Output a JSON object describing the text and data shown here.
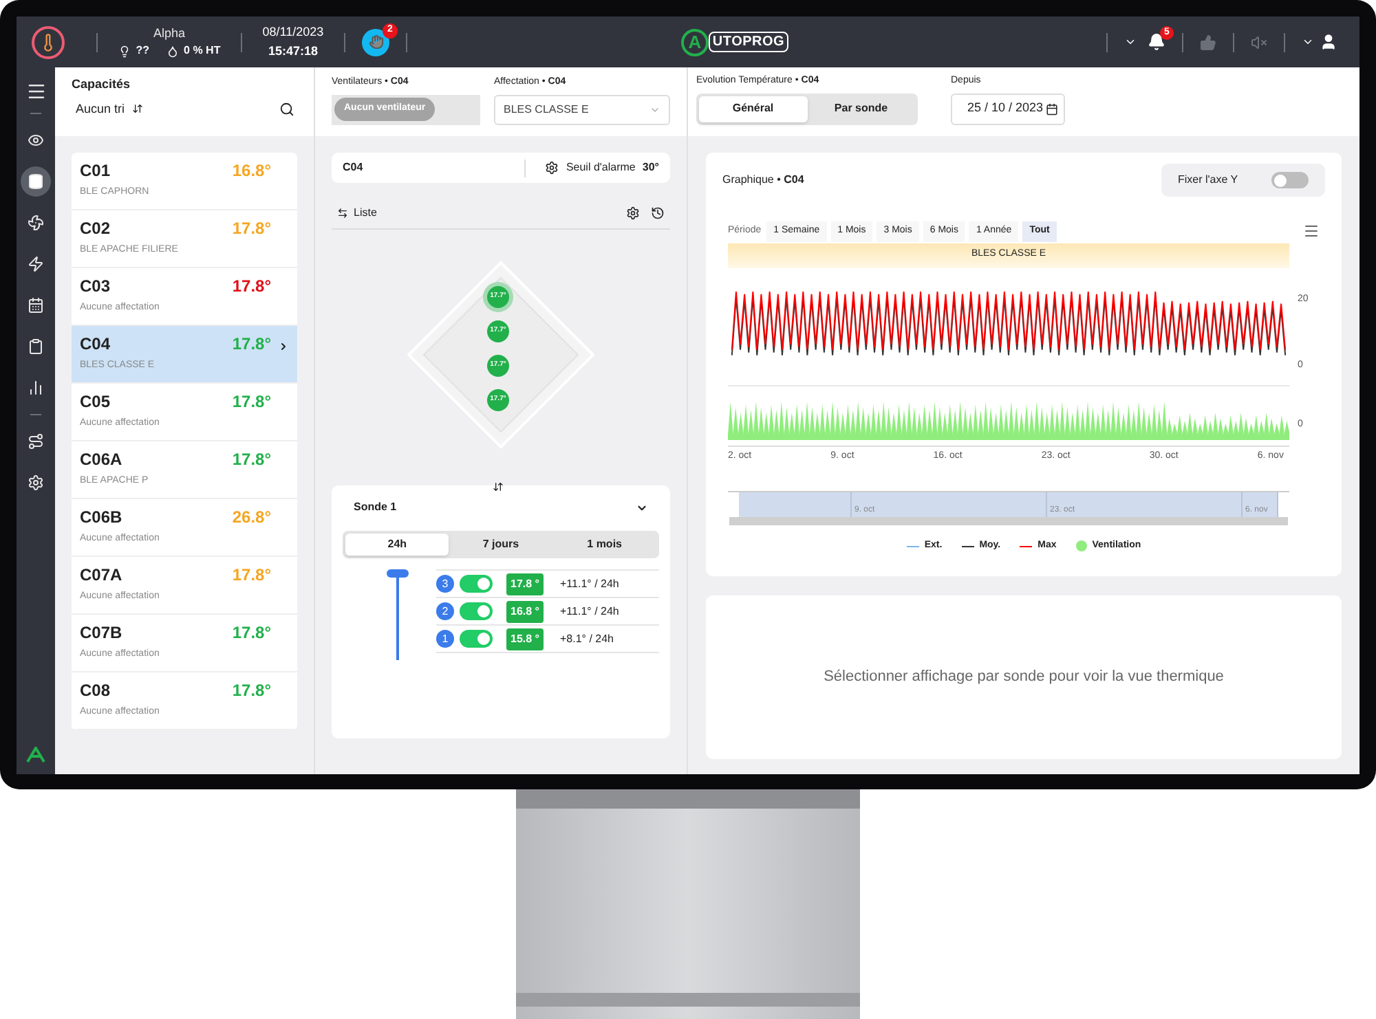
{
  "topbar": {
    "site": "Alpha",
    "sensor_value": "??",
    "humidity": "0 % HT",
    "date": "08/11/2023",
    "time": "15:47:18",
    "alerts_badge": "2",
    "logo_letter": "A",
    "logo_text": "UTOPROG",
    "notifications_badge": "5"
  },
  "nav": {
    "items": [
      {
        "selected": false
      },
      {
        "selected": true
      },
      {
        "selected": false
      },
      {
        "selected": false
      },
      {
        "selected": false
      },
      {
        "selected": false
      },
      {
        "selected": false
      },
      {
        "selected": false
      },
      {
        "selected": false
      }
    ]
  },
  "capacities": {
    "title": "Capacités",
    "sort": "Aucun tri",
    "items": [
      {
        "name": "C01",
        "assignment": "BLE CAPHORN",
        "temperature": "16.8°",
        "color": "#f5a623",
        "selected": false
      },
      {
        "name": "C02",
        "assignment": "BLE APACHE FILIERE",
        "temperature": "17.8°",
        "color": "#f5a623",
        "selected": false
      },
      {
        "name": "C03",
        "assignment": "Aucune affectation",
        "temperature": "17.8°",
        "color": "#e0101a",
        "selected": false
      },
      {
        "name": "C04",
        "assignment": "BLES CLASSE E",
        "temperature": "17.8°",
        "color": "#22b04b",
        "selected": true
      },
      {
        "name": "C05",
        "assignment": "Aucune affectation",
        "temperature": "17.8°",
        "color": "#22b04b",
        "selected": false
      },
      {
        "name": "C06A",
        "assignment": "BLE APACHE P",
        "temperature": "17.8°",
        "color": "#22b04b",
        "selected": false
      },
      {
        "name": "C06B",
        "assignment": "Aucune affectation",
        "temperature": "26.8°",
        "color": "#f5a623",
        "selected": false
      },
      {
        "name": "C07A",
        "assignment": "Aucune affectation",
        "temperature": "17.8°",
        "color": "#f5a623",
        "selected": false
      },
      {
        "name": "C07B",
        "assignment": "Aucune affectation",
        "temperature": "17.8°",
        "color": "#22b04b",
        "selected": false
      },
      {
        "name": "C08",
        "assignment": "Aucune affectation",
        "temperature": "17.8°",
        "color": "#22b04b",
        "selected": false
      }
    ]
  },
  "cell_header": {
    "fans_label": "Ventilateurs • **C04**",
    "fans_value": "Aucun ventilateur",
    "assignment_label": "Affectation • **C04**",
    "assignment_value": "BLES CLASSE E"
  },
  "cell": {
    "name": "C04",
    "alarm_label": "Seuil d'alarme",
    "alarm_value": "30°",
    "view_toggle": "Liste",
    "probes": [
      {
        "reading": "17.7°",
        "selected": true
      },
      {
        "reading": "17.7°",
        "selected": false
      },
      {
        "reading": "17.7°",
        "selected": false
      },
      {
        "reading": "17.7°",
        "selected": false
      }
    ]
  },
  "probe_panel": {
    "title": "Sonde 1",
    "tabs": [
      {
        "label": "24h",
        "selected": true
      },
      {
        "label": "7 jours",
        "selected": false
      },
      {
        "label": "1 mois",
        "selected": false
      }
    ],
    "depth_slider": {
      "level": 1
    },
    "sensors": [
      {
        "number": "3",
        "on": true,
        "temperature": "17.8 °",
        "trend": "+11.1° / 24h"
      },
      {
        "number": "2",
        "on": true,
        "temperature": "16.8 °",
        "trend": "+11.1° / 24h"
      },
      {
        "number": "1",
        "on": true,
        "temperature": "15.8 °",
        "trend": "+8.1° / 24h"
      }
    ]
  },
  "history": {
    "title": "Evolution Température • **C04**",
    "tabs": [
      {
        "label": "Général",
        "selected": true
      },
      {
        "label": "Par sonde",
        "selected": false
      }
    ],
    "since_label": "Depuis",
    "since_value": "25 / 10 / 2023",
    "chart_title": "Graphique • **C04**",
    "fix_axis": {
      "label": "Fixer l'axe Y",
      "on": false
    },
    "period_label": "Période",
    "periods": [
      {
        "label": "1 Semaine",
        "selected": false
      },
      {
        "label": "1 Mois",
        "selected": false
      },
      {
        "label": "3 Mois",
        "selected": false
      },
      {
        "label": "6 Mois",
        "selected": false
      },
      {
        "label": "1 Année",
        "selected": false
      },
      {
        "label": "Tout",
        "selected": true
      }
    ],
    "band": "BLES CLASSE E",
    "y_labels": [
      "20",
      "0"
    ],
    "ventilation_y_label": "0",
    "x_labels": [
      "2. oct",
      "9. oct",
      "16. oct",
      "23. oct",
      "30. oct",
      "6. nov"
    ],
    "navigator_labels": [
      "9. oct",
      "23. oct",
      "6. nov"
    ],
    "legend": [
      {
        "label": "Ext.",
        "kind": "line",
        "color": "#7cb5ec"
      },
      {
        "label": "Moy.",
        "kind": "line",
        "color": "#333333"
      },
      {
        "label": "Max",
        "kind": "line",
        "color": "#ff0000"
      },
      {
        "label": "Ventilation",
        "kind": "dot",
        "color": "#90ed7d"
      }
    ]
  },
  "thermal_message": "Sélectionner affichage par sonde pour voir la vue thermique"
}
